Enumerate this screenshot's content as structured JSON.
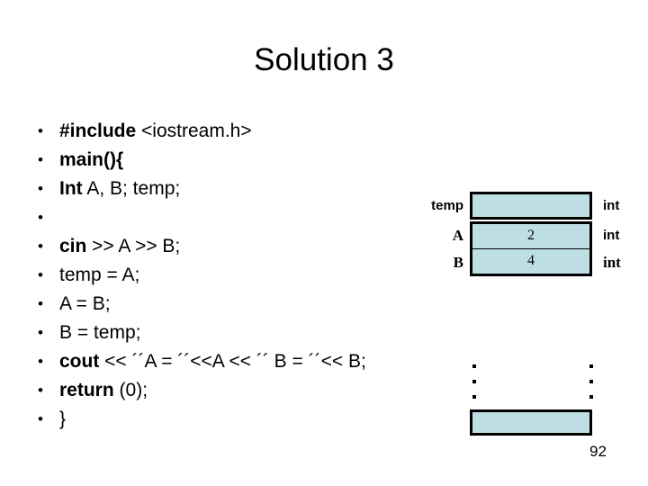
{
  "slide": {
    "title": "Solution 3",
    "page_number": "92",
    "background_color": "#ffffff",
    "cell_fill_color": "#bddfe4",
    "cell_border_color": "#000000"
  },
  "bullet_char": "•",
  "code_lines": [
    {
      "keyword": "#include",
      "rest": " <iostream.h>"
    },
    {
      "keyword": "main(){",
      "rest": ""
    },
    {
      "keyword": "Int",
      "rest": " A, B; temp;"
    },
    {
      "keyword": "",
      "rest": ""
    },
    {
      "keyword": "cin",
      "rest": " >> A >> B;"
    },
    {
      "keyword": "",
      "rest": "temp = A;"
    },
    {
      "keyword": "",
      "rest": "A = B;"
    },
    {
      "keyword": "",
      "rest": "B = temp;"
    },
    {
      "keyword": "cout",
      "rest": " << ´´A = ´´<<A << ´´ B = ´´<< B;"
    },
    {
      "keyword": "return",
      "rest": " (0);"
    },
    {
      "keyword": "",
      "rest": "}"
    }
  ],
  "memory": {
    "rows": [
      {
        "variable": "temp",
        "value": "",
        "type": "int"
      },
      {
        "variable": "A",
        "value": "2",
        "type": "int"
      },
      {
        "variable": "B",
        "value": "4",
        "type": "int"
      }
    ],
    "ellipsis_dots": 3,
    "bottom_cell_value": ""
  }
}
